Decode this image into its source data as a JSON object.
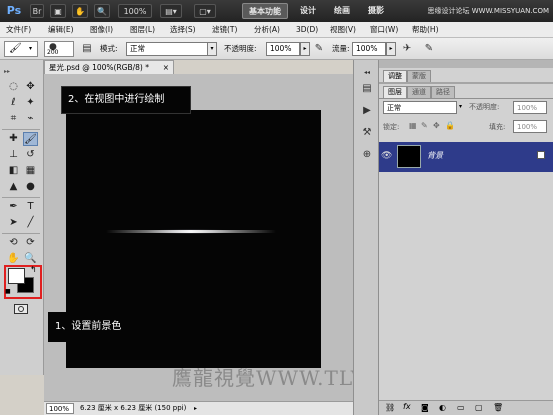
{
  "app": {
    "logo": "Ps",
    "zoom": "100%",
    "workspaces": [
      "基本功能",
      "设计",
      "绘画",
      "摄影"
    ],
    "watermark_top": "思缘设计论坛 WWW.MISSYUAN.COM"
  },
  "menu": [
    "文件(F)",
    "编辑(E)",
    "图像(I)",
    "图层(L)",
    "选择(S)",
    "滤镜(T)",
    "分析(A)",
    "3D(D)",
    "视图(V)",
    "窗口(W)",
    "帮助(H)"
  ],
  "options": {
    "brush_size": "200",
    "mode_label": "模式:",
    "mode_value": "正常",
    "opacity_label": "不透明度:",
    "opacity_value": "100%",
    "flow_label": "流量:",
    "flow_value": "100%"
  },
  "document": {
    "tab_title": "星光.psd @ 100%(RGB/8) *",
    "status_zoom": "100%",
    "status_info": "6.23 厘米 x 6.23 厘米 (150 ppi)"
  },
  "callouts": {
    "step2": "2、在视图中进行绘制",
    "step1": "1、设置前景色"
  },
  "panels": {
    "top_tabs": [
      "调整",
      "蒙版"
    ],
    "layer_tabs": [
      "图层",
      "通道",
      "路径"
    ],
    "blend_mode": "正常",
    "opacity_label": "不透明度:",
    "opacity_value": "100%",
    "lock_label": "锁定:",
    "fill_label": "填充:",
    "fill_value": "100%",
    "layer_name": "背景"
  },
  "watermark_bottom": "鷹龍視覺WWW.TLVI.NET",
  "colors": {
    "foreground": "#ffffff",
    "background": "#000000",
    "selected_layer": "#2e3b8a",
    "callout_border": "#e02020"
  }
}
